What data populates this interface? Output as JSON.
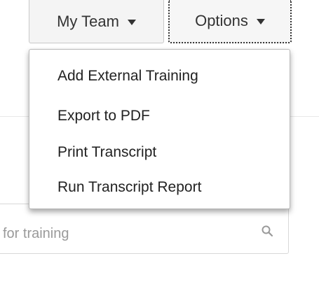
{
  "header": {
    "my_team_label": "My Team",
    "options_label": "Options"
  },
  "options_menu": {
    "items": [
      {
        "label": "Add External Training"
      },
      {
        "label": "Export to PDF"
      },
      {
        "label": "Print Transcript"
      },
      {
        "label": "Run Transcript Report"
      }
    ]
  },
  "search": {
    "placeholder_visible": "for training"
  },
  "icons": {
    "dropdown_caret": "caret-down-icon",
    "search": "search-icon"
  },
  "colors": {
    "button_bg": "#f4f4f4",
    "menu_bg": "#ffffff",
    "text": "#333333",
    "placeholder": "#9a9a9a"
  }
}
